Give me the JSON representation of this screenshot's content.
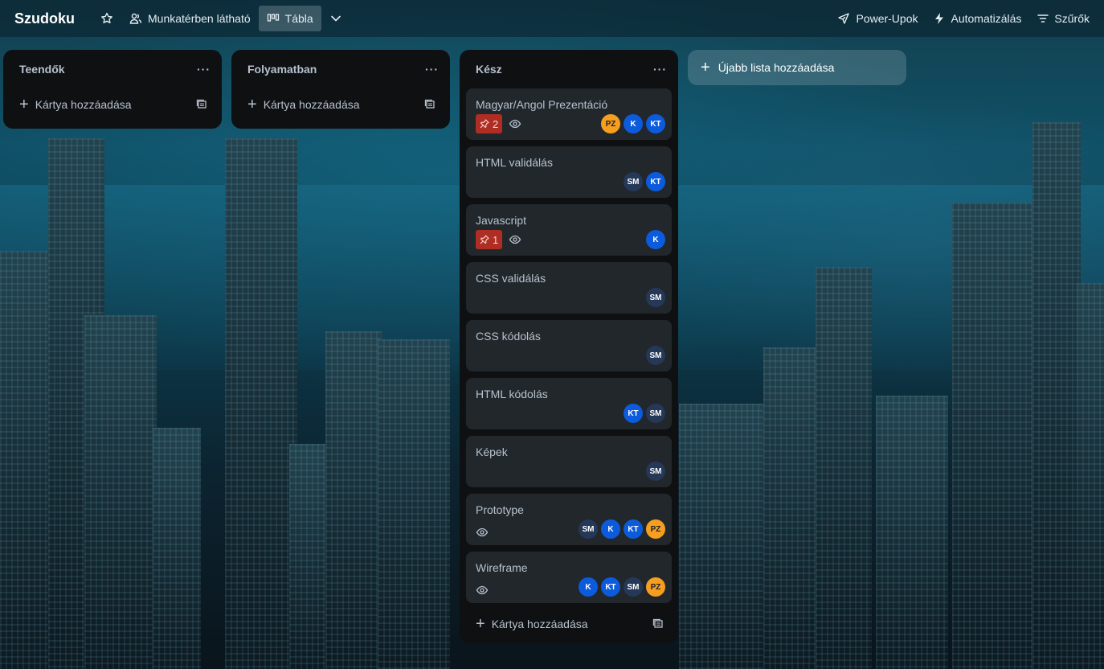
{
  "header": {
    "board_title": "Szudoku",
    "visibility_label": "Munkatérben látható",
    "view_label": "Tábla",
    "powerups_label": "Power-Upok",
    "automation_label": "Automatizálás",
    "filters_label": "Szűrők"
  },
  "lists": [
    {
      "title": "Teendők",
      "menu": "···",
      "add_card_label": "Kártya hozzáadása",
      "cards": []
    },
    {
      "title": "Folyamatban",
      "menu": "···",
      "add_card_label": "Kártya hozzáadása",
      "cards": []
    },
    {
      "title": "Kész",
      "menu": "···",
      "add_card_label": "Kártya hozzáadása",
      "cards": [
        {
          "title": "Magyar/Angol Prezentáció",
          "checklist": "2",
          "watching": true,
          "members": [
            "PZ",
            "K",
            "KT"
          ]
        },
        {
          "title": "HTML validálás",
          "members": [
            "SM",
            "KT"
          ]
        },
        {
          "title": "Javascript",
          "checklist": "1",
          "watching": true,
          "members": [
            "K"
          ]
        },
        {
          "title": "CSS validálás",
          "members": [
            "SM"
          ]
        },
        {
          "title": "CSS kódolás",
          "members": [
            "SM"
          ]
        },
        {
          "title": "HTML kódolás",
          "members": [
            "KT",
            "SM"
          ]
        },
        {
          "title": "Képek",
          "members": [
            "SM"
          ]
        },
        {
          "title": "Prototype",
          "watching": true,
          "members": [
            "SM",
            "K",
            "KT",
            "PZ"
          ]
        },
        {
          "title": "Wireframe",
          "watching": true,
          "members": [
            "K",
            "KT",
            "SM",
            "PZ"
          ]
        }
      ]
    }
  ],
  "add_list_label": "Újabb lista hozzáadása",
  "colors": {
    "list_bg": "#0f1012",
    "card_bg": "#22272b",
    "badge_red": "#ae2e24",
    "avatar_orange": "#f59e1f",
    "avatar_blue": "#0c5bdc",
    "avatar_dark": "#253858"
  }
}
